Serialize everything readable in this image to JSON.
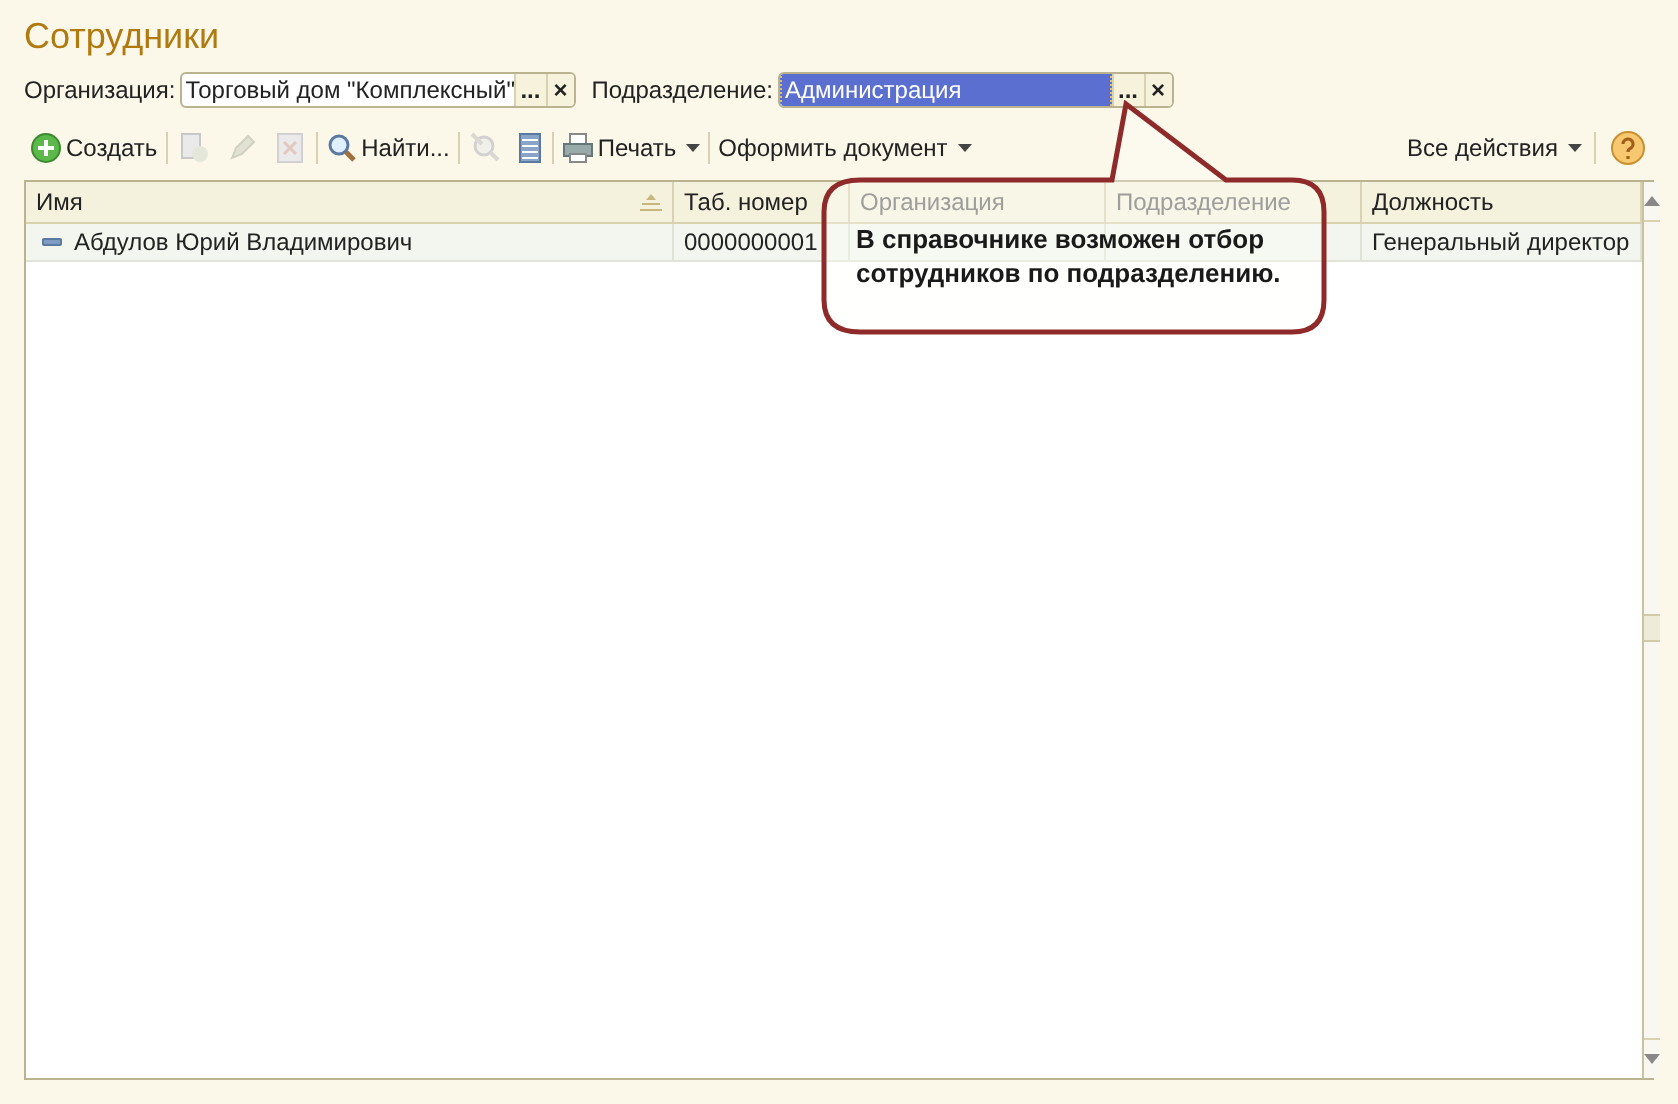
{
  "window": {
    "title": "Сотрудники"
  },
  "filters": [
    {
      "label": "Организация:",
      "value": "Торговый дом \"Комплексный\"",
      "selected": false,
      "select_button": "...",
      "clear_button": "×"
    },
    {
      "label": "Подразделение:",
      "value": "Администрация",
      "selected": true,
      "select_button": "...",
      "clear_button": "×"
    }
  ],
  "toolbar": {
    "items": [
      {
        "kind": "button",
        "label": "Создать",
        "disabled": false
      },
      {
        "kind": "icon",
        "disabled": true
      },
      {
        "kind": "icon",
        "disabled": true
      },
      {
        "kind": "icon",
        "disabled": true
      },
      {
        "kind": "button",
        "label": "Найти...",
        "disabled": false
      },
      {
        "kind": "icon",
        "disabled": true
      },
      {
        "kind": "icon",
        "disabled": false
      },
      {
        "kind": "menu",
        "label": "Печать",
        "disabled": false
      },
      {
        "kind": "menu",
        "label": "Оформить документ",
        "disabled": false
      }
    ],
    "right_items": [
      {
        "kind": "menu",
        "label": "Все действия",
        "disabled": false
      },
      {
        "kind": "icon",
        "disabled": false
      }
    ]
  },
  "table": {
    "columns": [
      {
        "label": "Имя",
        "faded": false
      },
      {
        "label": "Таб. номер",
        "faded": false
      },
      {
        "label": "Организация",
        "faded": true
      },
      {
        "label": "Подразделение",
        "faded": true
      },
      {
        "label": "Должность",
        "faded": false
      }
    ],
    "rows": [
      {
        "cells": [
          "Абдулов Юрий Владимирович",
          "0000000001",
          "",
          "",
          "Генеральный директор"
        ]
      }
    ]
  },
  "callout": {
    "text": "В справочнике возможен отбор сотрудников по подразделению."
  }
}
